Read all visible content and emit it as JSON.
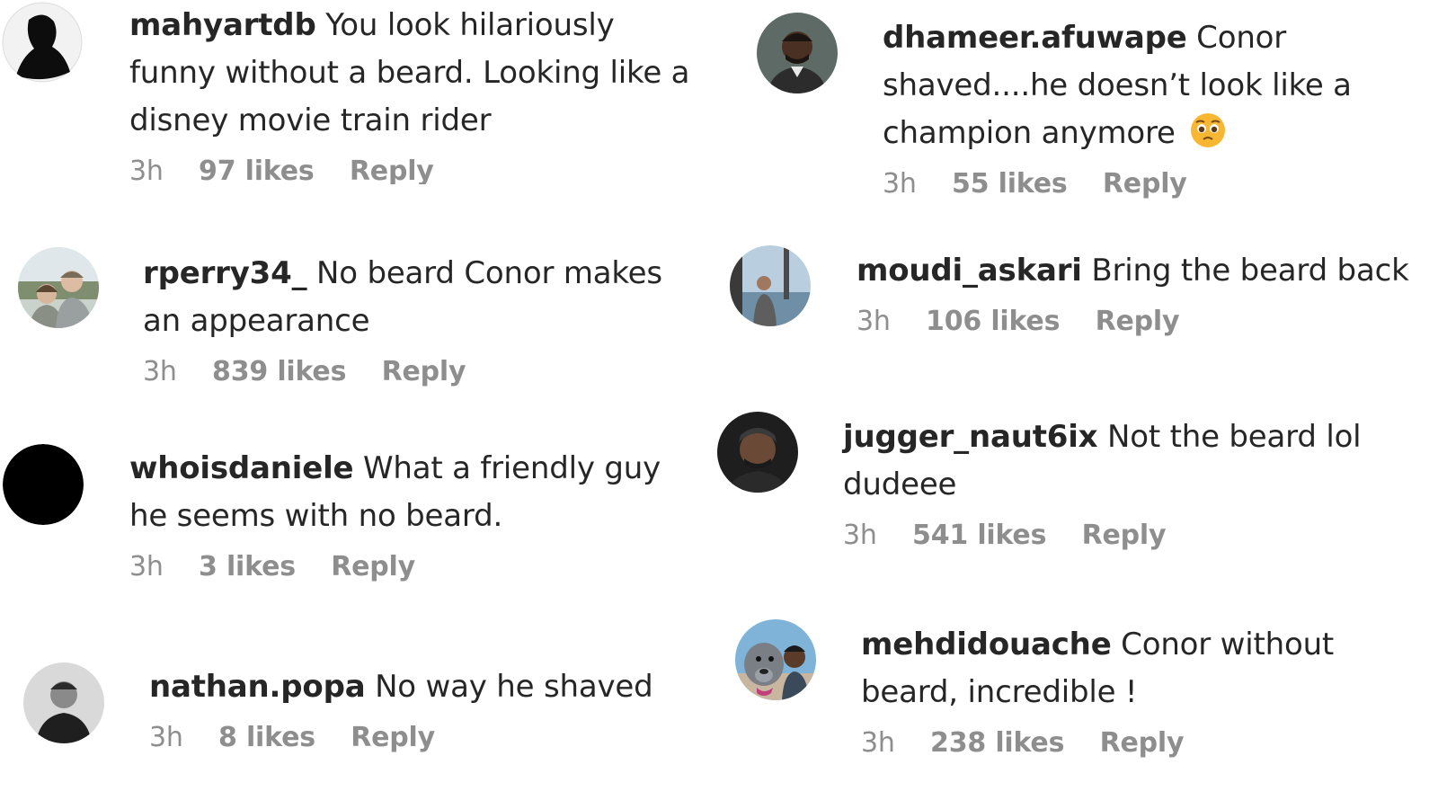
{
  "comments_left": [
    {
      "username": "mahyartdb",
      "text": "You look hilariously funny without a beard. Looking like a disney movie train rider",
      "time": "3h",
      "likes": "97 likes",
      "reply": "Reply",
      "avatar": "silhouette-profile"
    },
    {
      "username": "rperry34_",
      "text": "No beard Conor makes an appearance",
      "time": "3h",
      "likes": "839 likes",
      "reply": "Reply",
      "avatar": "couple-photo"
    },
    {
      "username": "whoisdaniele",
      "text": "What a friendly guy he seems with no beard.",
      "time": "3h",
      "likes": "3 likes",
      "reply": "Reply",
      "avatar": "black-circle"
    },
    {
      "username": "nathan.popa",
      "text": "No way he shaved",
      "time": "3h",
      "likes": "8 likes",
      "reply": "Reply",
      "avatar": "grayscale-portrait"
    }
  ],
  "comments_right": [
    {
      "username": "dhameer.afuwape",
      "text": "Conor shaved....he doesn’t look like a champion anymore",
      "emoji": "pleading-face-emoji",
      "time": "3h",
      "likes": "55 likes",
      "reply": "Reply",
      "avatar": "man-portrait"
    },
    {
      "username": "moudi_askari",
      "text": "Bring the beard back",
      "time": "3h",
      "likes": "106 likes",
      "reply": "Reply",
      "avatar": "boat-deck-photo"
    },
    {
      "username": "jugger_naut6ix",
      "text": "Not the beard lol dudeee",
      "time": "3h",
      "likes": "541 likes",
      "reply": "Reply",
      "avatar": "selfie-dark"
    },
    {
      "username": "mehdidouache",
      "text": "Conor without beard, incredible !",
      "time": "3h",
      "likes": "238 likes",
      "reply": "Reply",
      "avatar": "dog-and-man-photo"
    }
  ],
  "colors": {
    "text": "#262626",
    "muted": "#8e8e8e",
    "emoji": "#f7b733"
  }
}
